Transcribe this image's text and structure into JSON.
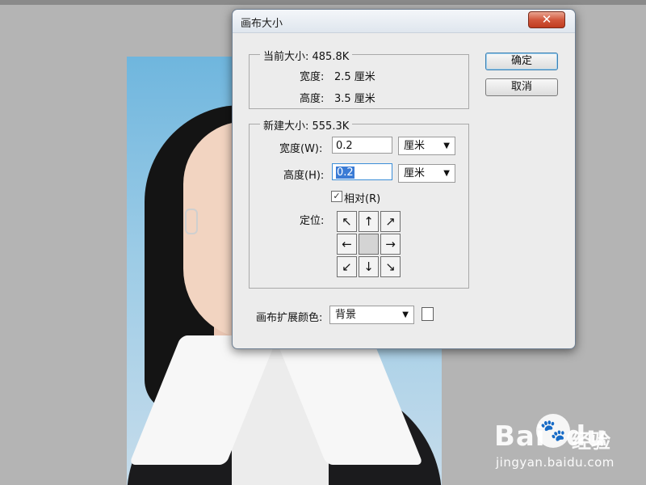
{
  "dialog": {
    "title": "画布大小",
    "close_symbol": "✕",
    "ok_label": "确定",
    "cancel_label": "取消"
  },
  "current_size": {
    "label": "当前大小: 485.8K",
    "width_label": "宽度:",
    "width_value": "2.5 厘米",
    "height_label": "高度:",
    "height_value": "3.5 厘米"
  },
  "new_size": {
    "label": "新建大小: 555.3K",
    "width_label": "宽度(W):",
    "width_value": "0.2",
    "width_unit": "厘米",
    "height_label": "高度(H):",
    "height_value": "0.2",
    "height_unit": "厘米",
    "relative_label": "相对(R)",
    "relative_checked": true,
    "anchor_label": "定位:",
    "anchor_arrows": [
      "↖",
      "↑",
      "↗",
      "←",
      "",
      "→",
      "↙",
      "↓",
      "↘"
    ]
  },
  "extension_color": {
    "label": "画布扩展颜色:",
    "value": "背景",
    "swatch_color": "#ffffff"
  },
  "watermark": {
    "logo": "Bai",
    "logo_tail": "du",
    "cn_text": "经验",
    "url": "jingyan.baidu.com"
  },
  "icons": {
    "dropdown": "▼",
    "checkmark": "✓",
    "paw": "🐾"
  }
}
